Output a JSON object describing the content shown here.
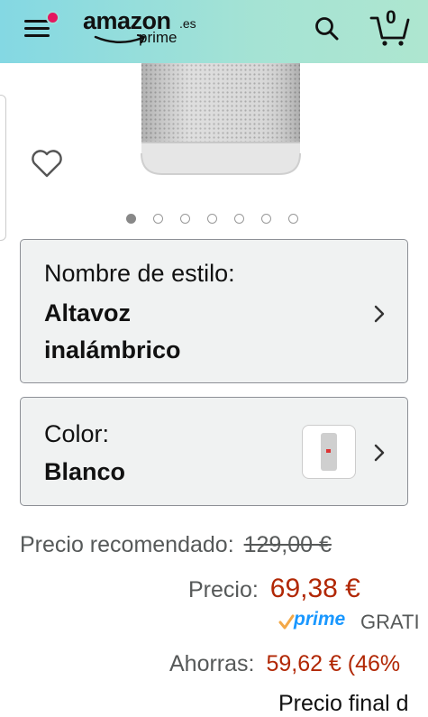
{
  "header": {
    "logo_word": "amazon",
    "logo_tld": ".es",
    "logo_prime": "prime",
    "cart_count": "0"
  },
  "gallery": {
    "dot_count": 7,
    "active_index": 0
  },
  "style_selector": {
    "label": "Nombre de estilo:",
    "value_line1": "Altavoz",
    "value_line2": "inalámbrico"
  },
  "color_selector": {
    "label": "Color:",
    "value": "Blanco"
  },
  "pricing": {
    "rrp_label": "Precio recomendado:",
    "rrp_value": "129,00 €",
    "price_label": "Precio:",
    "price_value": "69,38 €",
    "prime_word": "prime",
    "shipping_text": "GRATI",
    "savings_label": "Ahorras:",
    "savings_value": "59,62 € (46%",
    "final_price_text": "Precio final d"
  },
  "colors": {
    "header_start": "#84d8e3",
    "header_end": "#aee6d0",
    "price_red": "#b12704",
    "prime_blue": "#1a98ff",
    "notification": "#e4175f"
  }
}
